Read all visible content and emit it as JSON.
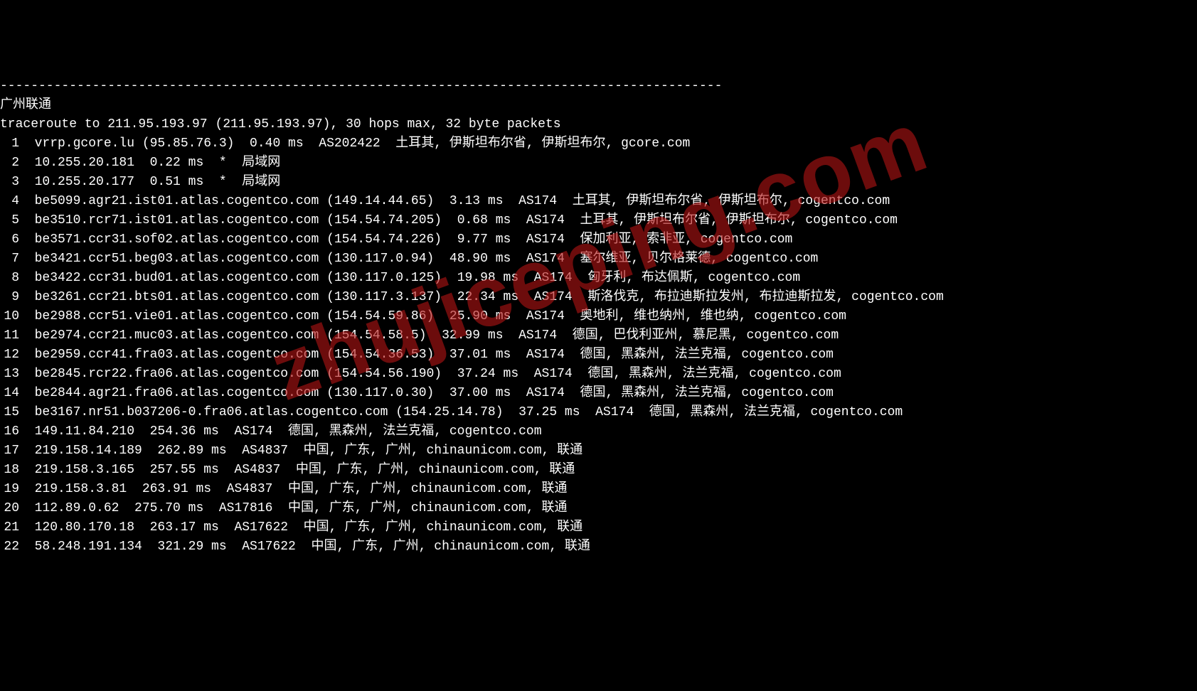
{
  "dashes": "----------------------------------------------------------------------------------------------",
  "location_header": "广州联通",
  "traceroute_header": "traceroute to 211.95.193.97 (211.95.193.97), 30 hops max, 32 byte packets",
  "watermark": "zhujiceping.com",
  "hops": [
    {
      "num": "1",
      "line": "  vrrp.gcore.lu (95.85.76.3)  0.40 ms  AS202422  土耳其, 伊斯坦布尔省, 伊斯坦布尔, gcore.com"
    },
    {
      "num": "2",
      "line": "  10.255.20.181  0.22 ms  *  局域网"
    },
    {
      "num": "3",
      "line": "  10.255.20.177  0.51 ms  *  局域网"
    },
    {
      "num": "4",
      "line": "  be5099.agr21.ist01.atlas.cogentco.com (149.14.44.65)  3.13 ms  AS174  土耳其, 伊斯坦布尔省, 伊斯坦布尔, cogentco.com"
    },
    {
      "num": "5",
      "line": "  be3510.rcr71.ist01.atlas.cogentco.com (154.54.74.205)  0.68 ms  AS174  土耳其, 伊斯坦布尔省, 伊斯坦布尔, cogentco.com"
    },
    {
      "num": "6",
      "line": "  be3571.ccr31.sof02.atlas.cogentco.com (154.54.74.226)  9.77 ms  AS174  保加利亚, 索非亚, cogentco.com"
    },
    {
      "num": "7",
      "line": "  be3421.ccr51.beg03.atlas.cogentco.com (130.117.0.94)  48.90 ms  AS174  塞尔维亚, 贝尔格莱德, cogentco.com"
    },
    {
      "num": "8",
      "line": "  be3422.ccr31.bud01.atlas.cogentco.com (130.117.0.125)  19.98 ms  AS174  匈牙利, 布达佩斯, cogentco.com"
    },
    {
      "num": "9",
      "line": "  be3261.ccr21.bts01.atlas.cogentco.com (130.117.3.137)  22.34 ms  AS174  斯洛伐克, 布拉迪斯拉发州, 布拉迪斯拉发, cogentco.com"
    },
    {
      "num": "10",
      "line": "  be2988.ccr51.vie01.atlas.cogentco.com (154.54.59.86)  25.90 ms  AS174  奥地利, 维也纳州, 维也纳, cogentco.com"
    },
    {
      "num": "11",
      "line": "  be2974.ccr21.muc03.atlas.cogentco.com (154.54.58.5)  32.99 ms  AS174  德国, 巴伐利亚州, 慕尼黑, cogentco.com"
    },
    {
      "num": "12",
      "line": "  be2959.ccr41.fra03.atlas.cogentco.com (154.54.36.53)  37.01 ms  AS174  德国, 黑森州, 法兰克福, cogentco.com"
    },
    {
      "num": "13",
      "line": "  be2845.rcr22.fra06.atlas.cogentco.com (154.54.56.190)  37.24 ms  AS174  德国, 黑森州, 法兰克福, cogentco.com"
    },
    {
      "num": "14",
      "line": "  be2844.agr21.fra06.atlas.cogentco.com (130.117.0.30)  37.00 ms  AS174  德国, 黑森州, 法兰克福, cogentco.com"
    },
    {
      "num": "15",
      "line": "  be3167.nr51.b037206-0.fra06.atlas.cogentco.com (154.25.14.78)  37.25 ms  AS174  德国, 黑森州, 法兰克福, cogentco.com"
    },
    {
      "num": "16",
      "line": "  149.11.84.210  254.36 ms  AS174  德国, 黑森州, 法兰克福, cogentco.com"
    },
    {
      "num": "17",
      "line": "  219.158.14.189  262.89 ms  AS4837  中国, 广东, 广州, chinaunicom.com, 联通"
    },
    {
      "num": "18",
      "line": "  219.158.3.165  257.55 ms  AS4837  中国, 广东, 广州, chinaunicom.com, 联通"
    },
    {
      "num": "19",
      "line": "  219.158.3.81  263.91 ms  AS4837  中国, 广东, 广州, chinaunicom.com, 联通"
    },
    {
      "num": "20",
      "line": "  112.89.0.62  275.70 ms  AS17816  中国, 广东, 广州, chinaunicom.com, 联通"
    },
    {
      "num": "21",
      "line": "  120.80.170.18  263.17 ms  AS17622  中国, 广东, 广州, chinaunicom.com, 联通"
    },
    {
      "num": "22",
      "line": "  58.248.191.134  321.29 ms  AS17622  中国, 广东, 广州, chinaunicom.com, 联通"
    }
  ]
}
